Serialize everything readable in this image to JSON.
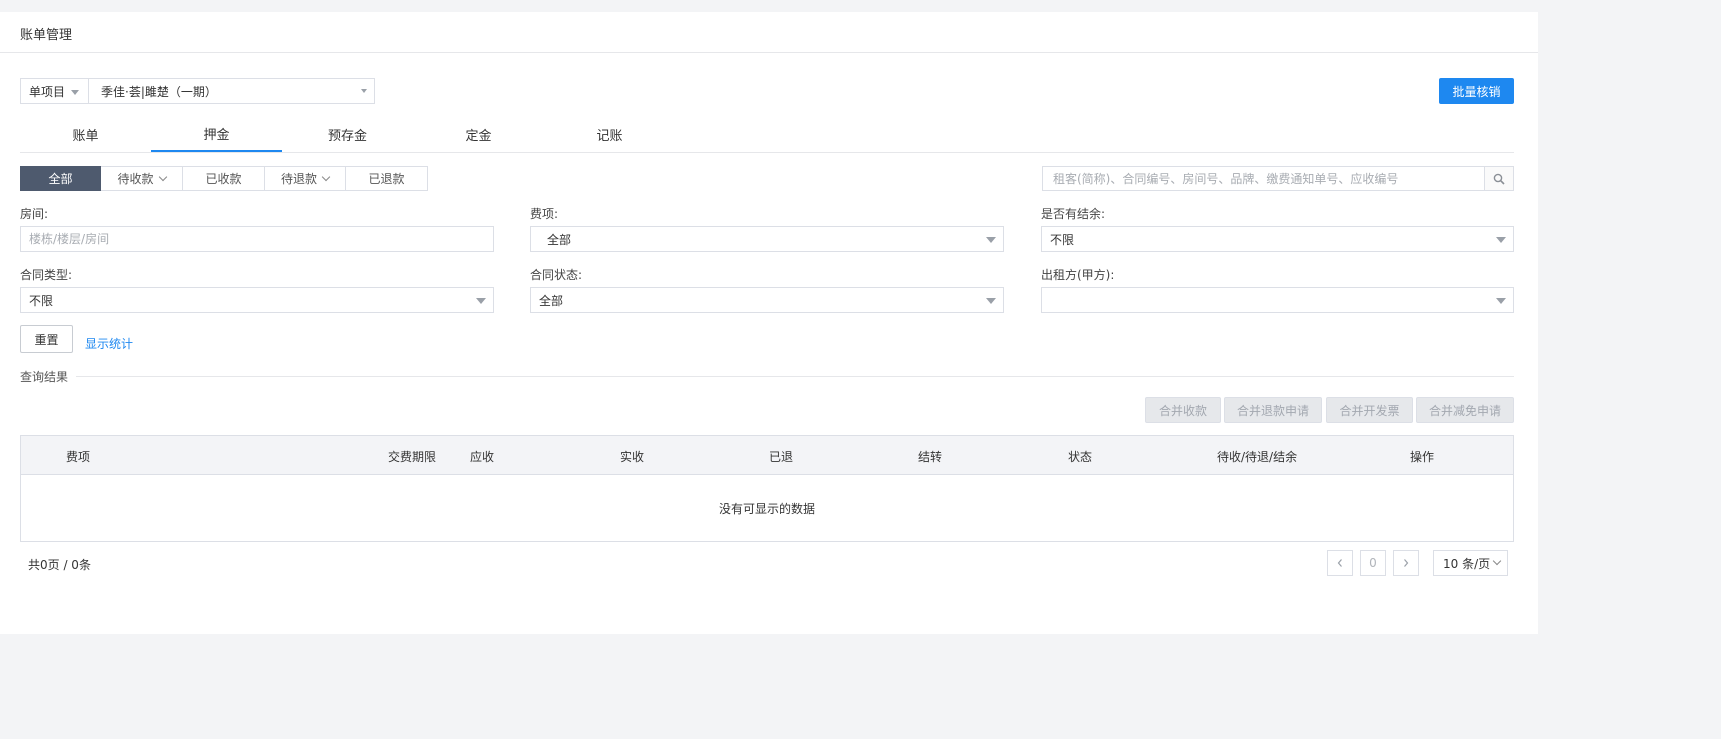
{
  "page": {
    "title": "账单管理"
  },
  "project": {
    "type_label": "单项目",
    "name": "季佳·荟|雎楚（一期）"
  },
  "actions": {
    "batch_writeoff": "批量核销"
  },
  "tabs": [
    "账单",
    "押金",
    "预存金",
    "定金",
    "记账"
  ],
  "active_tab": "押金",
  "status_filters": [
    "全部",
    "待收款",
    "已收款",
    "待退款",
    "已退款"
  ],
  "search": {
    "placeholder": "租客(简称)、合同编号、房间号、品牌、缴费通知单号、应收编号"
  },
  "filters": {
    "room": {
      "label": "房间:",
      "placeholder": "楼栋/楼层/房间"
    },
    "fee": {
      "label": "费项:",
      "value": "全部"
    },
    "balance": {
      "label": "是否有结余:",
      "value": "不限"
    },
    "contract_type": {
      "label": "合同类型:",
      "value": "不限"
    },
    "contract_status": {
      "label": "合同状态:",
      "value": "全部"
    },
    "lessor": {
      "label": "出租方(甲方):",
      "value": ""
    }
  },
  "buttons": {
    "reset": "重置",
    "show_stats": "显示统计"
  },
  "results": {
    "title": "查询结果",
    "actions": [
      "合并收款",
      "合并退款申请",
      "合并开发票",
      "合并减免申请"
    ]
  },
  "table": {
    "columns": [
      "费项",
      "交费期限",
      "应收",
      "实收",
      "已退",
      "结转",
      "状态",
      "待收/待退/结余",
      "操作"
    ],
    "empty": "没有可显示的数据"
  },
  "pagination": {
    "summary": "共0页 / 0条",
    "page": "0",
    "page_size": "10 条/页"
  }
}
